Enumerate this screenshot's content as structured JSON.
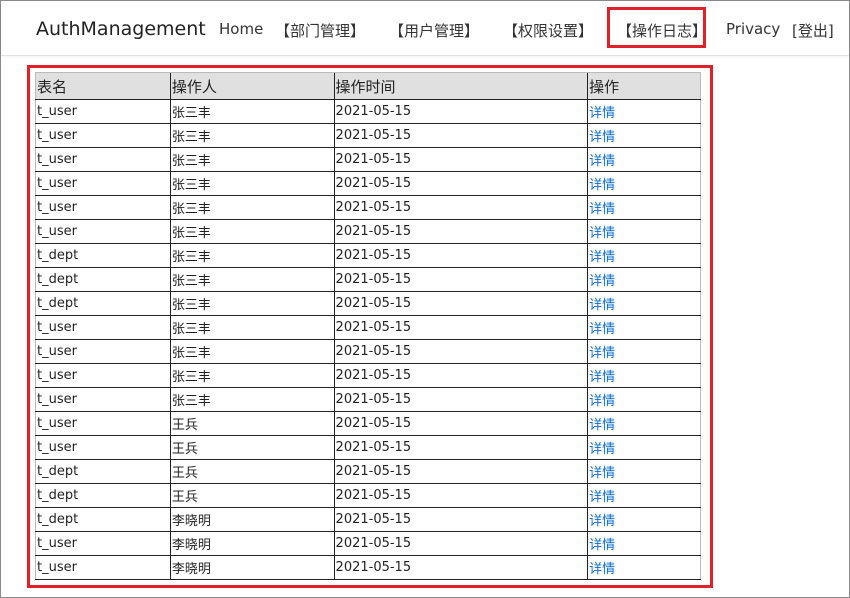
{
  "nav": {
    "brand": "AuthManagement",
    "links": [
      "Home",
      "【部门管理】",
      "【用户管理】",
      "【权限设置】",
      "【操作日志】",
      "Privacy",
      "[登出]"
    ],
    "active": "【操作日志】"
  },
  "table": {
    "headers": [
      "表名",
      "操作人",
      "操作时间",
      "操作"
    ],
    "rows": [
      [
        "t_user",
        "张三丰",
        "2021-05-15",
        "详情"
      ],
      [
        "t_user",
        "张三丰",
        "2021-05-15",
        "详情"
      ],
      [
        "t_user",
        "张三丰",
        "2021-05-15",
        "详情"
      ],
      [
        "t_user",
        "张三丰",
        "2021-05-15",
        "详情"
      ],
      [
        "t_user",
        "张三丰",
        "2021-05-15",
        "详情"
      ],
      [
        "t_user",
        "张三丰",
        "2021-05-15",
        "详情"
      ],
      [
        "t_dept",
        "张三丰",
        "2021-05-15",
        "详情"
      ],
      [
        "t_dept",
        "张三丰",
        "2021-05-15",
        "详情"
      ],
      [
        "t_dept",
        "张三丰",
        "2021-05-15",
        "详情"
      ],
      [
        "t_user",
        "张三丰",
        "2021-05-15",
        "详情"
      ],
      [
        "t_user",
        "张三丰",
        "2021-05-15",
        "详情"
      ],
      [
        "t_user",
        "张三丰",
        "2021-05-15",
        "详情"
      ],
      [
        "t_user",
        "张三丰",
        "2021-05-15",
        "详情"
      ],
      [
        "t_user",
        "王兵",
        "2021-05-15",
        "详情"
      ],
      [
        "t_user",
        "王兵",
        "2021-05-15",
        "详情"
      ],
      [
        "t_dept",
        "王兵",
        "2021-05-15",
        "详情"
      ],
      [
        "t_dept",
        "王兵",
        "2021-05-15",
        "详情"
      ],
      [
        "t_dept",
        "李晓明",
        "2021-05-15",
        "详情"
      ],
      [
        "t_user",
        "李晓明",
        "2021-05-15",
        "详情"
      ],
      [
        "t_user",
        "李晓明",
        "2021-05-15",
        "详情"
      ]
    ]
  },
  "colors": {
    "highlight": "#e0202a",
    "link": "#0a6fd6",
    "header_bg": "#e0e0e0"
  }
}
